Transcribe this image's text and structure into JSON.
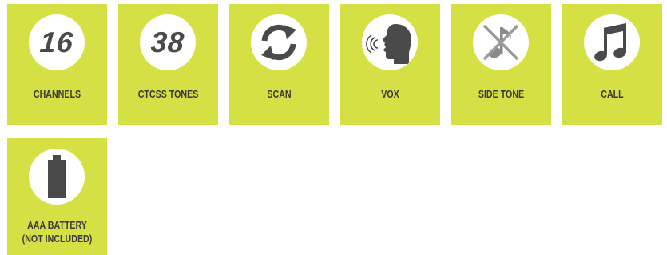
{
  "colors": {
    "tile_background": "#d5e044",
    "icon_circle": "#ffffff",
    "icon_fill": "#4a4a4a",
    "label_text": "#3a3a3a"
  },
  "features": [
    {
      "icon": "number-16-icon",
      "number": "16",
      "label": "CHANNELS"
    },
    {
      "icon": "number-38-icon",
      "number": "38",
      "label": "CTCSS TONES"
    },
    {
      "icon": "scan-arrows-icon",
      "label": "SCAN"
    },
    {
      "icon": "voice-head-icon",
      "label": "VOX"
    },
    {
      "icon": "muted-note-icon",
      "label": "SIDE TONE"
    },
    {
      "icon": "music-note-icon",
      "label": "CALL"
    },
    {
      "icon": "battery-icon",
      "label_line1": "AAA BATTERY",
      "label_line2": "(NOT INCLUDED)"
    }
  ]
}
